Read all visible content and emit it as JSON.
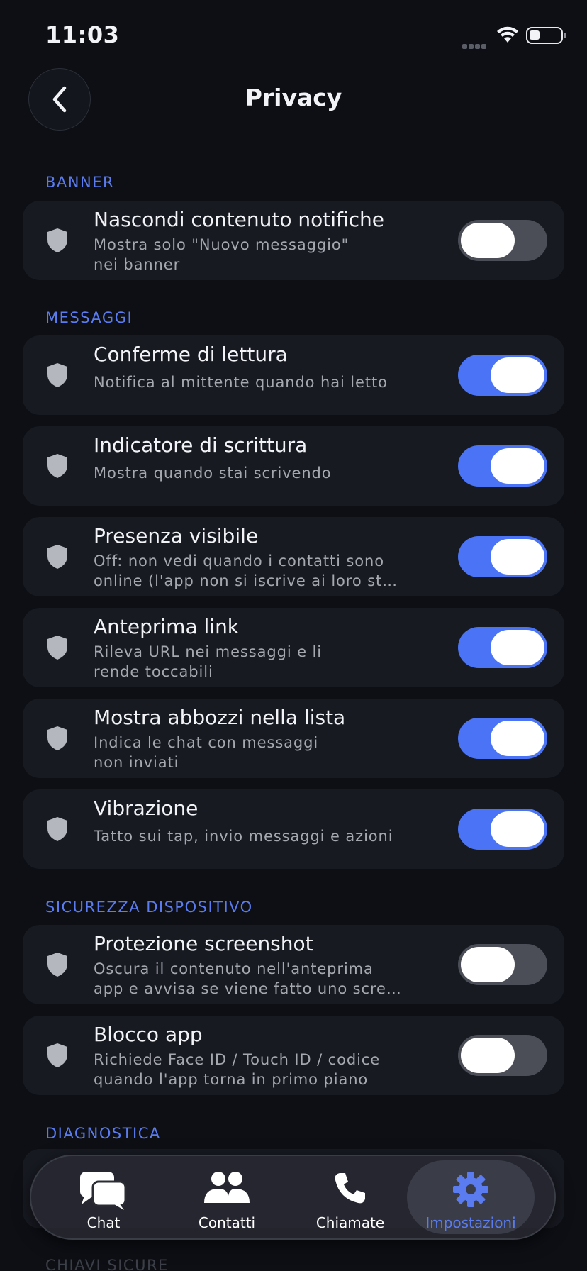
{
  "status": {
    "time": "11:03"
  },
  "header": {
    "title": "Privacy"
  },
  "sections": {
    "banner": "BANNER",
    "messaggi": "MESSAGGI",
    "sicurezza": "SICUREZZA DISPOSITIVO",
    "diagnostica": "DIAGNOSTICA",
    "chiavi": "CHIAVI SICURE"
  },
  "settings": [
    {
      "title": "Nascondi contenuto notifiche",
      "subtitle": [
        "Mostra solo \"Nuovo messaggio\"",
        "nei banner"
      ],
      "enabled": false
    },
    {
      "title": "Conferme di lettura",
      "subtitle": [
        "Notifica al mittente quando hai letto"
      ],
      "enabled": true
    },
    {
      "title": "Indicatore di scrittura",
      "subtitle": [
        "Mostra quando stai scrivendo"
      ],
      "enabled": true
    },
    {
      "title": "Presenza visibile",
      "subtitle": [
        "Off: non vedi quando i contatti sono",
        "online (l'app non si iscrive ai loro st…"
      ],
      "enabled": true
    },
    {
      "title": "Anteprima link",
      "subtitle": [
        "Rileva URL nei messaggi e li",
        "rende toccabili"
      ],
      "enabled": true
    },
    {
      "title": "Mostra abbozzi nella lista",
      "subtitle": [
        "Indica le chat con messaggi",
        "non inviati"
      ],
      "enabled": true
    },
    {
      "title": "Vibrazione",
      "subtitle": [
        "Tatto sui tap, invio messaggi e azioni"
      ],
      "enabled": true
    },
    {
      "title": "Protezione screenshot",
      "subtitle": [
        "Oscura il contenuto nell'anteprima",
        "app e avvisa se viene fatto uno scre…"
      ],
      "enabled": false
    },
    {
      "title": "Blocco app",
      "subtitle": [
        "Richiede Face ID / Touch ID / codice",
        "quando l'app torna in primo piano"
      ],
      "enabled": false
    }
  ],
  "tabs": [
    {
      "label": "Chat",
      "icon": "chat-bubbles-icon"
    },
    {
      "label": "Contatti",
      "icon": "contacts-icon"
    },
    {
      "label": "Chiamate",
      "icon": "phone-icon"
    },
    {
      "label": "Impostazioni",
      "icon": "gear-icon",
      "active": true
    }
  ],
  "colors": {
    "accent": "#4a74f5",
    "section": "#5b7cf0",
    "background": "#0d0f15",
    "card": "#181a22"
  }
}
